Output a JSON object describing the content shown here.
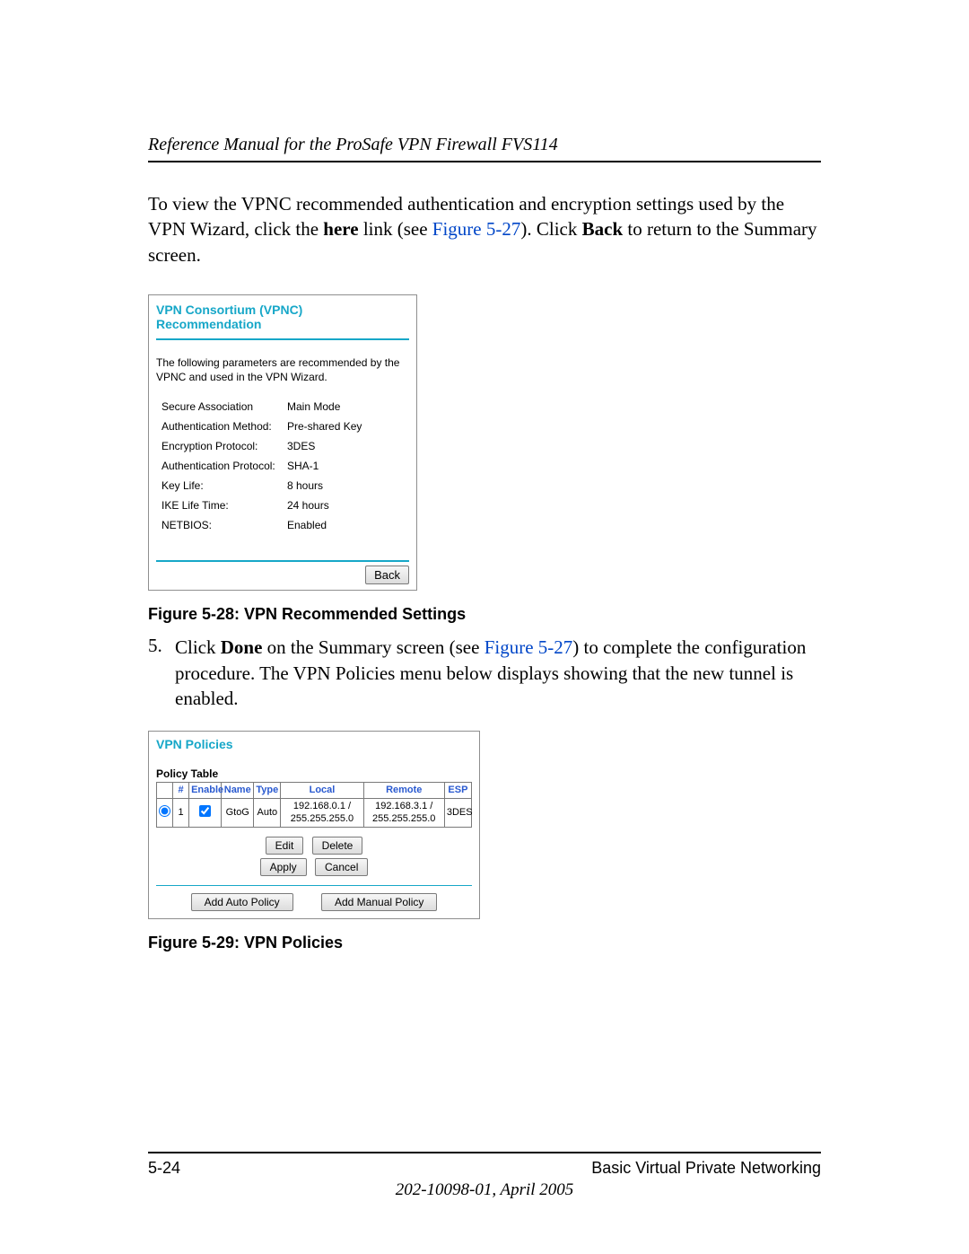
{
  "header": {
    "title": "Reference Manual for the ProSafe VPN Firewall FVS114"
  },
  "intro": {
    "pre_here": "To view the VPNC recommended authentication and encryption settings used by the VPN Wizard, click the ",
    "here": "here",
    "mid": " link (see ",
    "figref1": "Figure 5-27",
    "post": "). Click ",
    "back": "Back",
    "tail": " to return to the Summary screen."
  },
  "panel1": {
    "title": "VPN Consortium (VPNC) Recommendation",
    "intro": "The following parameters are recommended by the VPNC and used in the VPN Wizard.",
    "rows": [
      {
        "label": "Secure Association",
        "value": "Main Mode"
      },
      {
        "label": "Authentication Method:",
        "value": "Pre-shared Key"
      },
      {
        "label": "Encryption Protocol:",
        "value": "3DES"
      },
      {
        "label": "Authentication Protocol:",
        "value": "SHA-1"
      },
      {
        "label": "Key Life:",
        "value": "8 hours"
      },
      {
        "label": "IKE Life Time:",
        "value": "24 hours"
      },
      {
        "label": "NETBIOS:",
        "value": "Enabled"
      }
    ],
    "back_label": "Back"
  },
  "fig28_caption": "Figure 5-28:  VPN Recommended Settings",
  "step5": {
    "num": "5.",
    "pre": "Click ",
    "done": "Done",
    "mid": " on the Summary screen (see ",
    "figref": "Figure 5-27",
    "tail": ") to complete the configuration procedure. The VPN Policies menu below displays showing that the new tunnel is enabled."
  },
  "panel2": {
    "title": "VPN Policies",
    "table_label": "Policy Table",
    "headers": {
      "num": "#",
      "enable": "Enable",
      "name": "Name",
      "type": "Type",
      "local": "Local",
      "remote": "Remote",
      "esp": "ESP"
    },
    "row": {
      "num": "1",
      "name": "GtoG",
      "type": "Auto",
      "local": "192.168.0.1 / 255.255.255.0",
      "remote": "192.168.3.1 / 255.255.255.0",
      "esp": "3DES"
    },
    "edit": "Edit",
    "delete": "Delete",
    "apply": "Apply",
    "cancel": "Cancel",
    "add_auto": "Add Auto Policy",
    "add_manual": "Add Manual Policy"
  },
  "fig29_caption": "Figure 5-29:  VPN Policies",
  "footer": {
    "page": "5-24",
    "section": "Basic Virtual Private Networking",
    "docid": "202-10098-01, April 2005"
  }
}
